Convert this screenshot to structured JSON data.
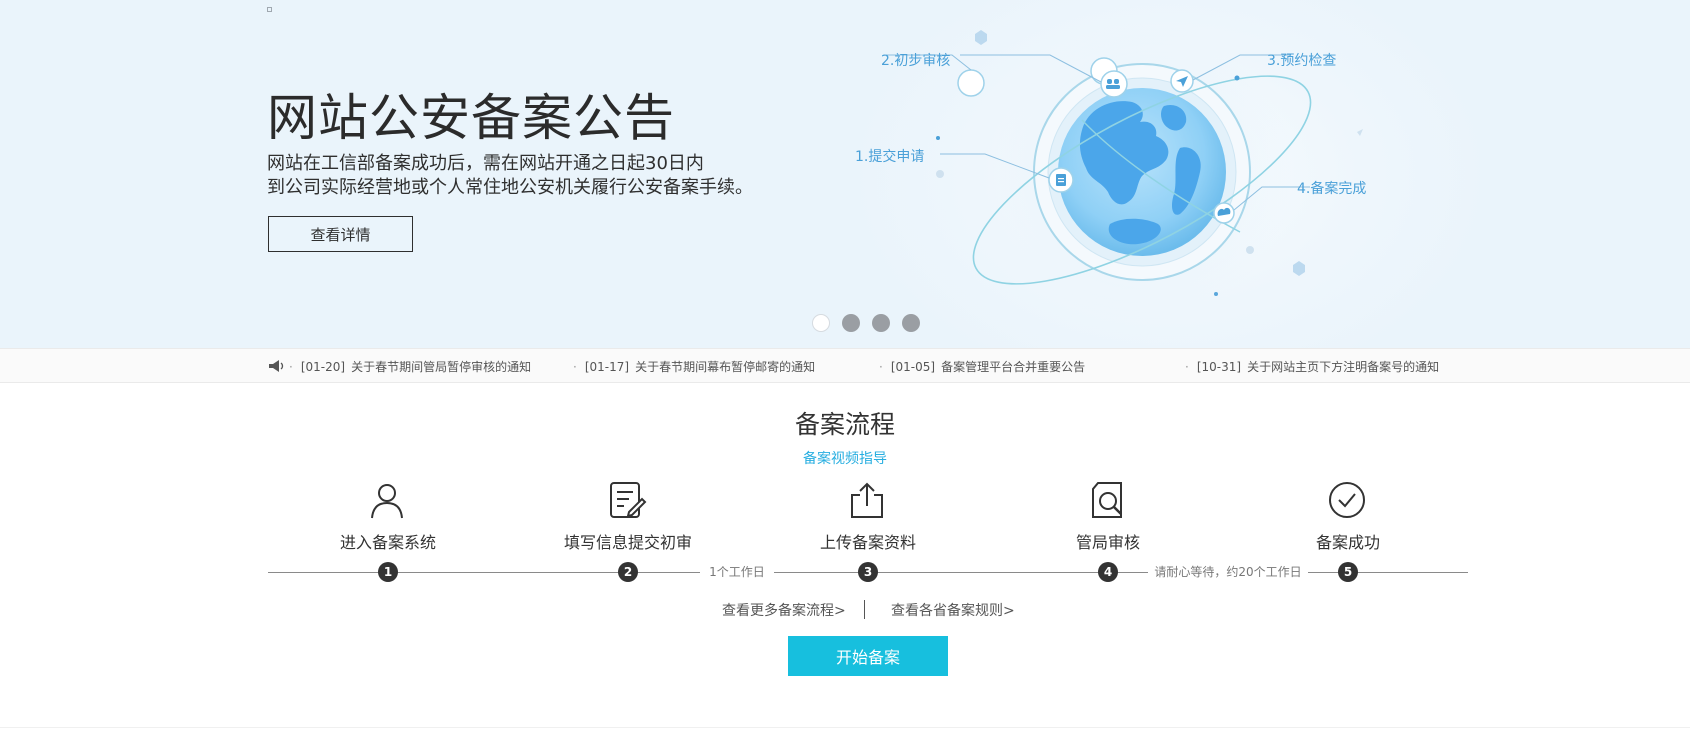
{
  "banner": {
    "title": "网站公安备案公告",
    "desc_line1": "网站在工信部备案成功后，需在网站开通之日起30日内",
    "desc_line2": "到公司实际经营地或个人常住地公安机关履行公安备案手续。",
    "detail_button": "查看详情",
    "illustration_steps": [
      "1.提交申请",
      "2.初步审核",
      "3.预约检查",
      "4.备案完成"
    ],
    "slides_count": 4,
    "active_slide": 1
  },
  "notices": [
    {
      "date": "[01-20]",
      "text": "关于春节期间管局暂停审核的通知"
    },
    {
      "date": "[01-17]",
      "text": "关于春节期间幕布暂停邮寄的通知"
    },
    {
      "date": "[01-05]",
      "text": "备案管理平台合并重要公告"
    },
    {
      "date": "[10-31]",
      "text": "关于网站主页下方注明备案号的通知"
    }
  ],
  "process": {
    "title": "备案流程",
    "video_link": "备案视频指导",
    "steps": [
      {
        "number": "1",
        "label": "进入备案系统",
        "icon": "user-icon"
      },
      {
        "number": "2",
        "label": "填写信息提交初审",
        "icon": "edit-form-icon"
      },
      {
        "number": "3",
        "label": "上传备案资料",
        "icon": "upload-icon"
      },
      {
        "number": "4",
        "label": "管局审核",
        "icon": "search-document-icon"
      },
      {
        "number": "5",
        "label": "备案成功",
        "icon": "check-circle-icon"
      }
    ],
    "durations": [
      "1个工作日",
      "请耐心等待，约20个工作日"
    ],
    "more_link": "查看更多备案流程>",
    "rules_link": "查看各省备案规则>",
    "start_button": "开始备案"
  },
  "colors": {
    "banner_bg": "#eaf4fb",
    "accent_cyan": "#17bfde",
    "link_blue": "#27aee0",
    "illustration_blue": "#4aa0d8"
  }
}
